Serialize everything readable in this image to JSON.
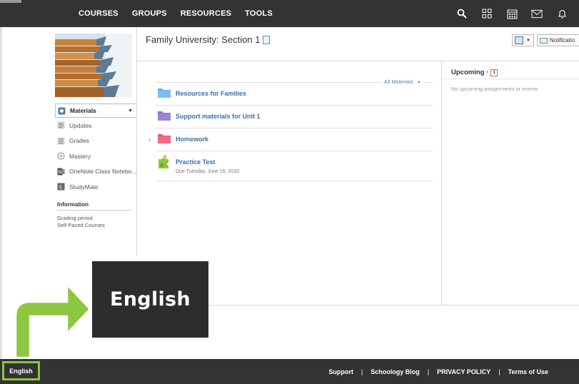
{
  "topnav": {
    "items": [
      "COURSES",
      "GROUPS",
      "RESOURCES",
      "TOOLS"
    ],
    "icons": [
      "search-icon",
      "apps-grid-icon",
      "calendar-icon",
      "mail-icon",
      "notifications-bell-icon"
    ]
  },
  "course": {
    "title": "Family University: Section 1"
  },
  "sidebar": {
    "items": [
      {
        "label": "Materials",
        "icon": "materials-icon",
        "active": true
      },
      {
        "label": "Updates",
        "icon": "updates-icon"
      },
      {
        "label": "Grades",
        "icon": "grades-icon"
      },
      {
        "label": "Mastery",
        "icon": "mastery-icon"
      },
      {
        "label": "OneNote Class Notebo...",
        "icon": "onenote-icon"
      },
      {
        "label": "StudyMate",
        "icon": "studymate-icon"
      }
    ],
    "info_heading": "Information",
    "grading_label": "Grading period",
    "grading_value": "Self-Paced Courses"
  },
  "toolbar": {
    "notifications_label": "Notificatio"
  },
  "materials": {
    "filter_label": "All Materials",
    "items": [
      {
        "label": "Resources for Families",
        "icon": "folder-blue-icon",
        "color": "#6aaee6"
      },
      {
        "label": "Support materials for Unit 1",
        "icon": "folder-purple-icon",
        "color": "#8d73c4"
      },
      {
        "label": "Homework",
        "icon": "folder-red-icon",
        "color": "#e8566d"
      },
      {
        "label": "Practice Test",
        "icon": "assessment-puzzle-icon",
        "subtext": "Due Tuesday, June 16, 2020"
      }
    ]
  },
  "upcoming": {
    "title": "Upcoming ·",
    "empty_text": "No upcoming assignments or events"
  },
  "callout": {
    "language_label": "English"
  },
  "footer": {
    "language_button": "English",
    "links": [
      "Support",
      "Schoology Blog",
      "PRIVACY POLICY",
      "Terms of Use"
    ],
    "separator": "|"
  },
  "colors": {
    "topbar": "#333333",
    "accent_link": "#3c6fa3",
    "highlight_green": "#8dc63f"
  }
}
